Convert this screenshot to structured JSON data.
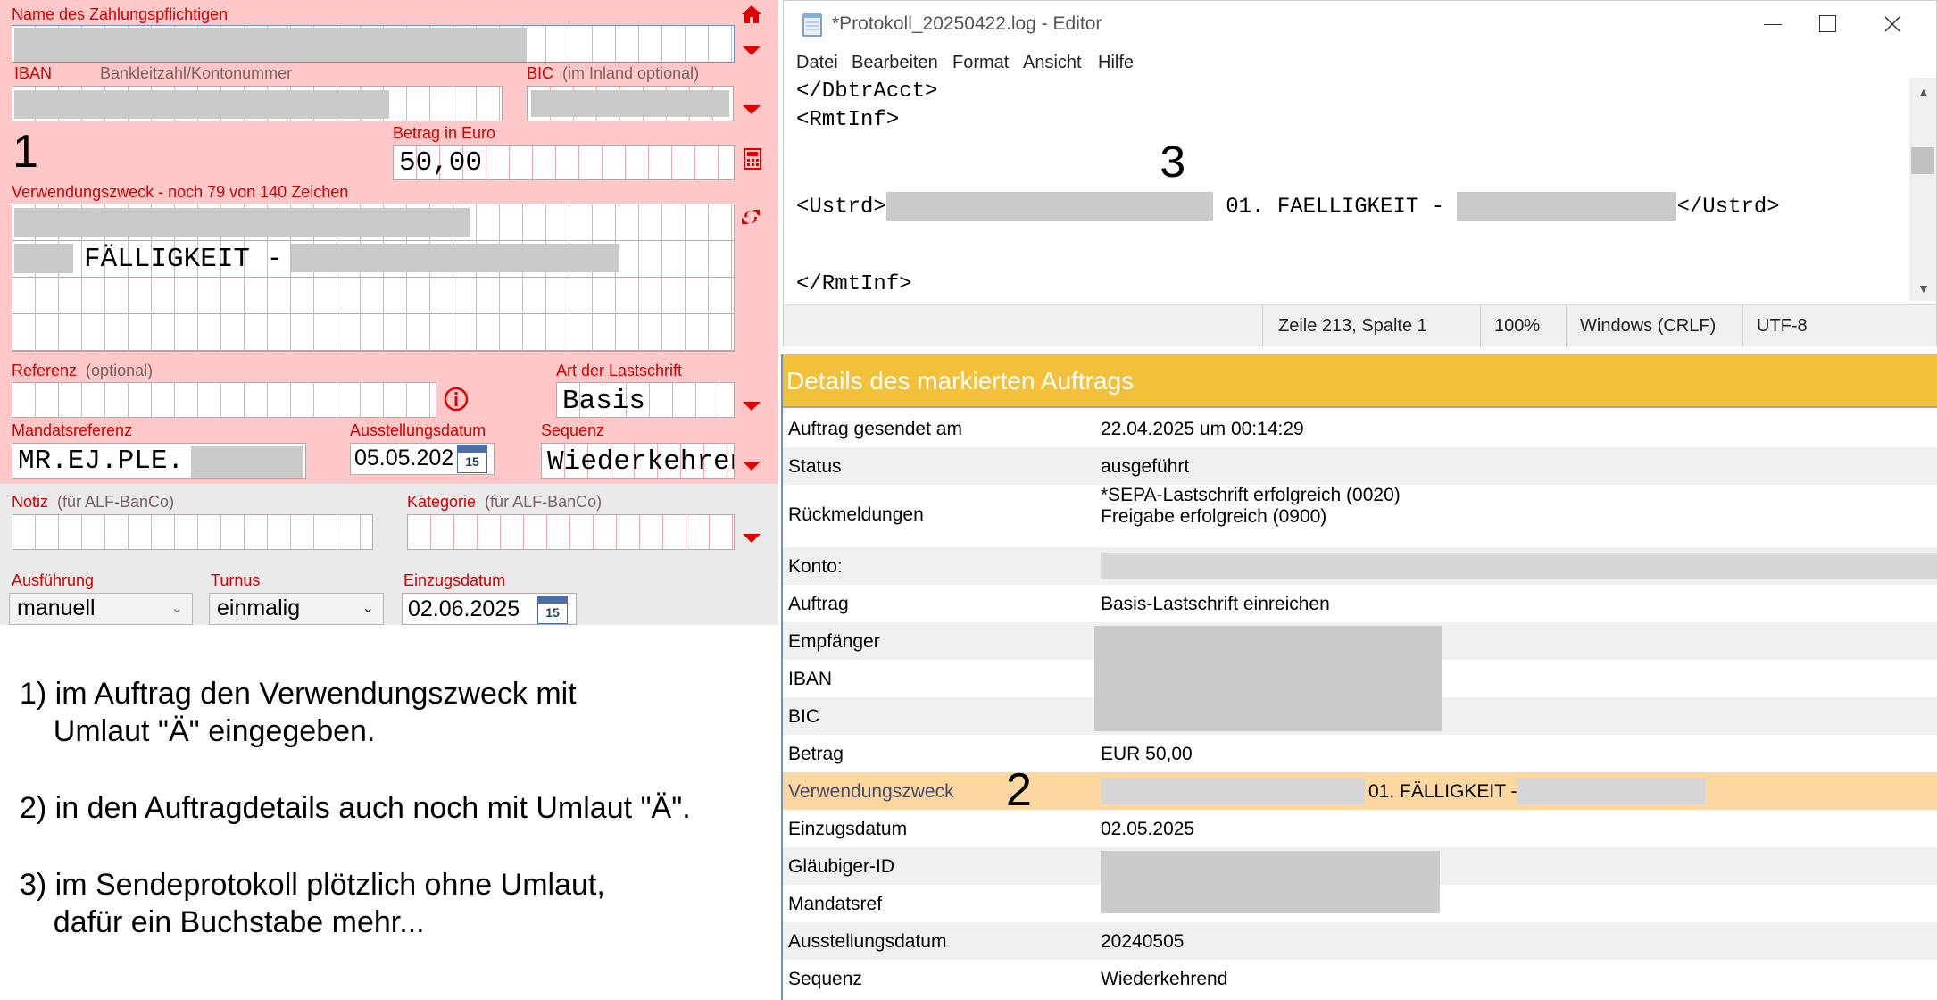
{
  "form": {
    "label_name": "Name des Zahlungspflichtigen",
    "label_iban": "IBAN",
    "label_blz": "Bankleitzahl/Kontonummer",
    "label_bic": "BIC",
    "label_bic_sub": "(im Inland optional)",
    "label_amount": "Betrag in Euro",
    "amount_value": "50,00",
    "label_purpose": "Verwendungszweck - noch 79 von 140 Zeichen",
    "purpose_line2": "FÄLLIGKEIT -",
    "label_reference": "Referenz",
    "label_reference_sub": "(optional)",
    "label_debit_type": "Art der Lastschrift",
    "debit_type_value": "Basis",
    "label_mandate": "Mandatsreferenz",
    "mandate_value": "MR.EJ.PLE.",
    "label_issue_date": "Ausstellungsdatum",
    "issue_date_value": "05.05.202",
    "label_sequence": "Sequenz",
    "sequence_value": "Wiederkehren",
    "label_note": "Notiz",
    "label_note_sub": "(für ALF-BanCo)",
    "label_category": "Kategorie",
    "label_category_sub": "(für ALF-BanCo)",
    "label_execution": "Ausführung",
    "execution_value": "manuell",
    "label_interval": "Turnus",
    "interval_value": "einmalig",
    "label_collection_date": "Einzugsdatum",
    "collection_date_value": "02.06.2025",
    "calendar_day": "15",
    "colors": {
      "background": "#ffc8c8",
      "label": "#d00000"
    }
  },
  "markers": {
    "one": "1",
    "two": "2",
    "three": "3"
  },
  "notes": {
    "n1": "1) im Auftrag den Verwendungszweck mit\n    Umlaut \"Ä\" eingegeben.",
    "n2": "2) in den Auftragdetails auch noch mit Umlaut \"Ä\".",
    "n3": "3) im Sendeprotokoll plötzlich ohne Umlaut,\n    dafür ein Buchstabe mehr..."
  },
  "editor": {
    "title": "*Protokoll_20250422.log - Editor",
    "menu": [
      "Datei",
      "Bearbeiten",
      "Format",
      "Ansicht",
      "Hilfe"
    ],
    "lines": {
      "l1": "</DbtrAcct>",
      "l2": "<RmtInf>",
      "l3a": "<Ustrd>",
      "l3b": " 01. FAELLIGKEIT - ",
      "l3c": "</Ustrd>",
      "l4": "</RmtInf>"
    },
    "status": {
      "position": "Zeile 213, Spalte 1",
      "zoom": "100%",
      "line_ending": "Windows (CRLF)",
      "encoding": "UTF-8"
    }
  },
  "details": {
    "header": "Details des markierten Auftrags",
    "header_color": "#f3c03c",
    "rows": [
      {
        "key": "Auftrag gesendet am",
        "value": "22.04.2025 um 00:14:29"
      },
      {
        "key": "Status",
        "value": "ausgeführt"
      },
      {
        "key": "Rückmeldungen",
        "value": "*SEPA-Lastschrift erfolgreich (0020)\nFreigabe erfolgreich (0900)"
      },
      {
        "key": "Konto:",
        "value": ""
      },
      {
        "key": "Auftrag",
        "value": "Basis-Lastschrift einreichen"
      },
      {
        "key": "Empfänger",
        "value": ""
      },
      {
        "key": "IBAN",
        "value": ""
      },
      {
        "key": "BIC",
        "value": ""
      },
      {
        "key": "Betrag",
        "value": "EUR 50,00"
      },
      {
        "key": "Verwendungszweck",
        "value": "01. FÄLLIGKEIT -"
      },
      {
        "key": "Einzugsdatum",
        "value": "02.05.2025"
      },
      {
        "key": "Gläubiger-ID",
        "value": ""
      },
      {
        "key": "Mandatsref",
        "value": ""
      },
      {
        "key": "Ausstellungsdatum",
        "value": "20240505"
      },
      {
        "key": "Sequenz",
        "value": "Wiederkehrend"
      }
    ]
  }
}
